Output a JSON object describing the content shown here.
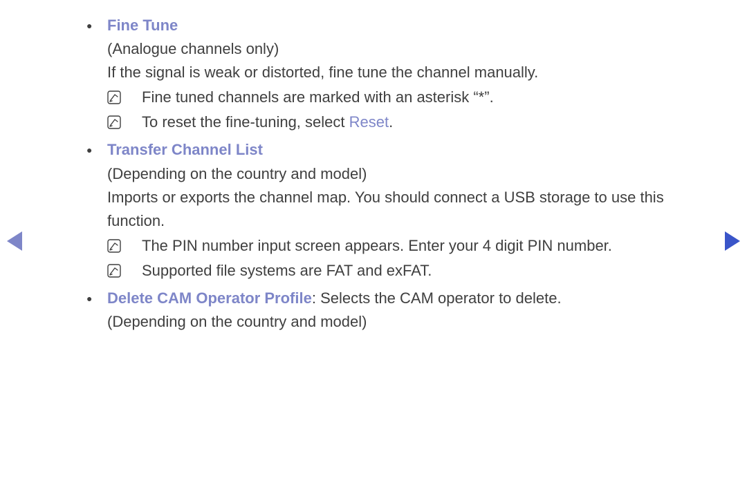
{
  "sections": [
    {
      "title": "Fine Tune",
      "subtitle": "(Analogue channels only)",
      "body": "If the signal is weak or distorted, fine tune the channel manually.",
      "notes": [
        {
          "text": "Fine tuned channels are marked with an asterisk “*”."
        },
        {
          "prefix": "To reset the fine-tuning, select ",
          "highlight": "Reset",
          "suffix": "."
        }
      ]
    },
    {
      "title": "Transfer Channel List",
      "subtitle": "(Depending on the country and model)",
      "body": "Imports or exports the channel map. You should connect a USB storage to use this function.",
      "notes": [
        {
          "text": "The PIN number input screen appears. Enter your 4 digit PIN number."
        },
        {
          "text": "Supported file systems are FAT and exFAT."
        }
      ]
    },
    {
      "title": "Delete CAM Operator Profile",
      "inline_after_title": ": Selects the CAM operator to delete.",
      "subtitle": "(Depending on the country and model)"
    }
  ]
}
